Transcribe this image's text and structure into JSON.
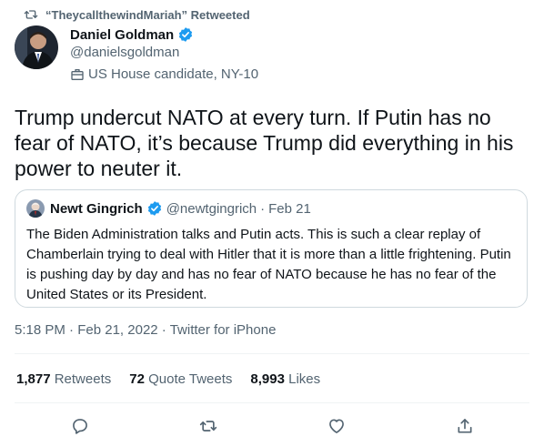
{
  "retweet_context": "“TheycallthewindMariah” Retweeted",
  "author": {
    "name": "Daniel Goldman",
    "handle": "@danielsgoldman",
    "bio": "US House candidate, NY-10"
  },
  "tweet": {
    "text": "Trump undercut NATO at every turn. If Putin has no fear of NATO, it’s because Trump did everything in his power to neuter it."
  },
  "quote": {
    "name": "Newt Gingrich",
    "handle": "@newtgingrich",
    "separator": "·",
    "date": "Feb 21",
    "text": "The Biden Administration talks and Putin acts. This is such a clear replay of Chamberlain trying to deal with Hitler that it is more than a little frightening. Putin is pushing day by day and has no fear of NATO because he has no fear of the United States or its President."
  },
  "meta": {
    "time": "5:18 PM",
    "sep1": "·",
    "date": "Feb 21, 2022",
    "sep2": "·",
    "source": "Twitter for iPhone"
  },
  "stats": {
    "retweets_count": "1,877",
    "retweets_label": "Retweets",
    "quotes_count": "72",
    "quotes_label": "Quote Tweets",
    "likes_count": "8,993",
    "likes_label": "Likes"
  },
  "colors": {
    "verified": "#1d9bf0",
    "secondary_text": "#536471",
    "border": "#cfd9de"
  },
  "icons": {
    "retweet_context": "retweet-icon",
    "verified": "verified-badge-icon",
    "bio": "briefcase-icon",
    "reply": "reply-icon",
    "retweet": "retweet-icon",
    "like": "heart-icon",
    "share": "share-icon"
  }
}
